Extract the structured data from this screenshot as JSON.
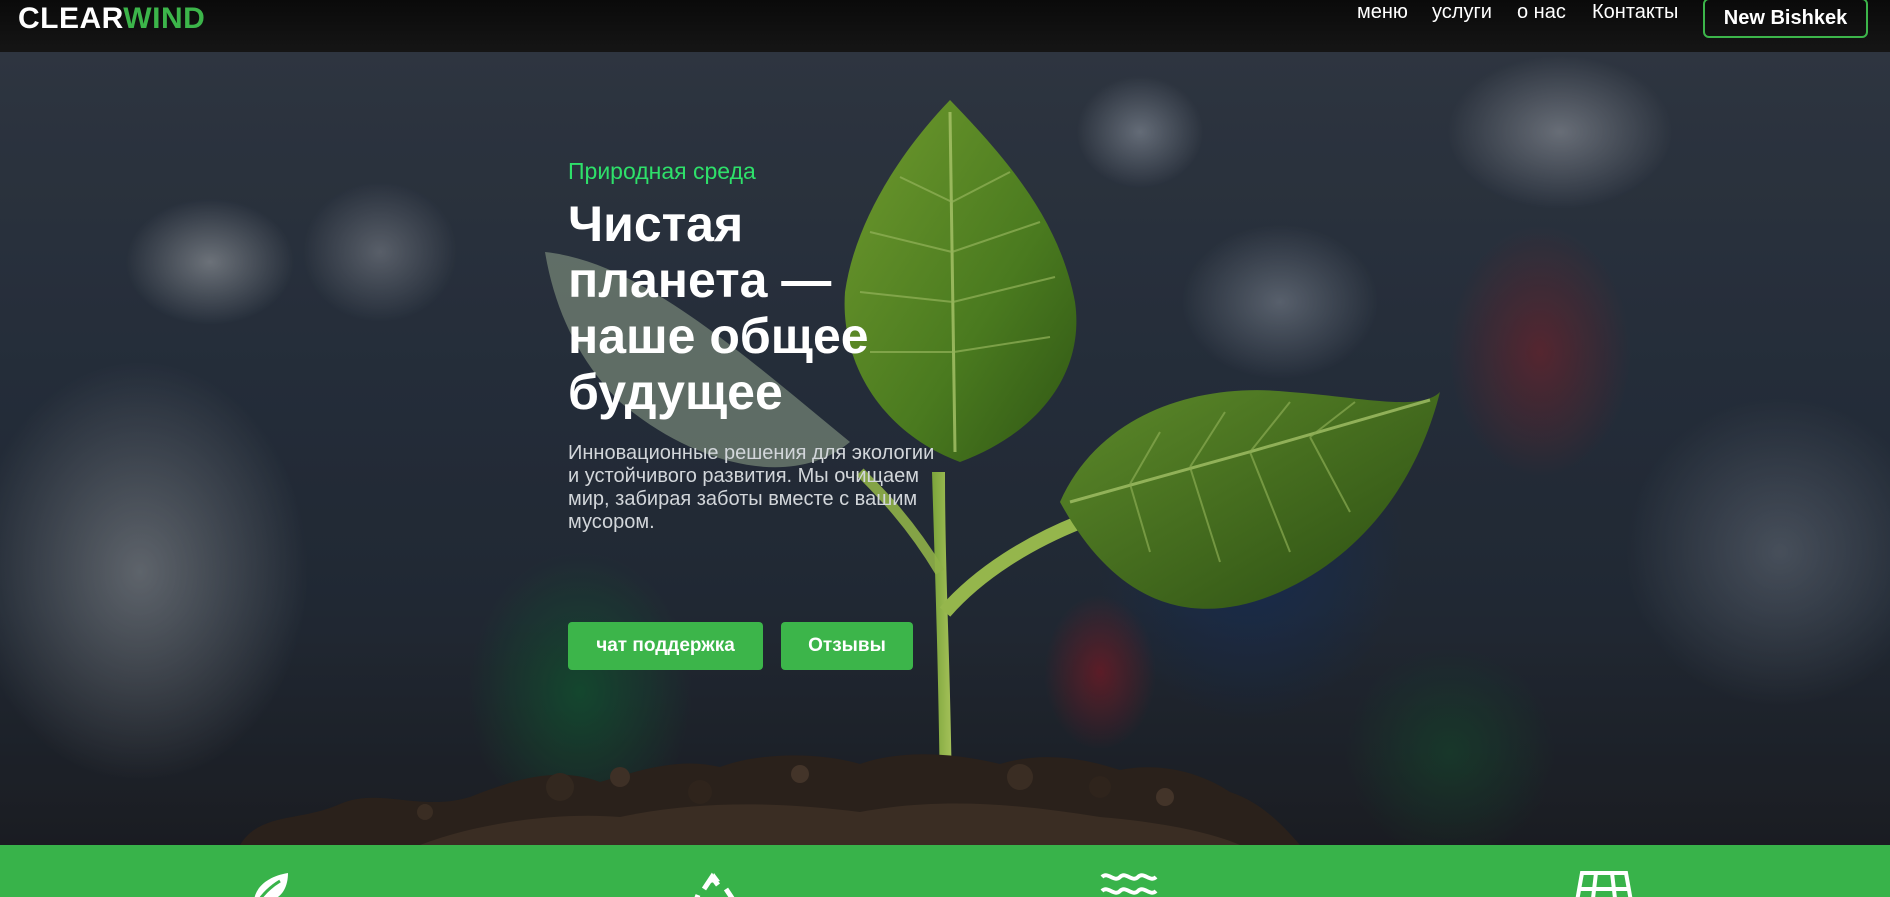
{
  "brand": {
    "part1": "CLEAR",
    "part2": "WIND",
    "accent": "#3cb54a"
  },
  "nav": {
    "links": [
      "меню",
      "услуги",
      "о нас",
      "Контакты"
    ],
    "cta": "New Bishkek"
  },
  "hero": {
    "kicker": "Природная среда",
    "title": "Чистая планета — наше общее будущее",
    "description": "Инновационные решения для экологии и устойчивого развития. Мы очищаем мир, забирая заботы вместе с вашим мусором.",
    "buttons": [
      "чат поддержка",
      "Отзывы"
    ],
    "kicker_color": "#2ee06a"
  },
  "features": {
    "icons": [
      "leaf-icon",
      "recycle-icon",
      "water-waves-icon",
      "solar-panel-icon"
    ],
    "bar_color": "#38b34a"
  }
}
